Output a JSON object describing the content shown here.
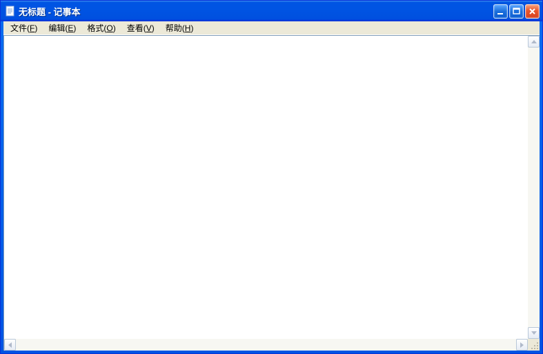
{
  "window": {
    "title": "无标题 - 记事本"
  },
  "menu": {
    "file": {
      "label": "文件",
      "accel": "F"
    },
    "edit": {
      "label": "编辑",
      "accel": "E"
    },
    "format": {
      "label": "格式",
      "accel": "O"
    },
    "view": {
      "label": "查看",
      "accel": "V"
    },
    "help": {
      "label": "帮助",
      "accel": "H"
    }
  },
  "editor": {
    "content": ""
  }
}
